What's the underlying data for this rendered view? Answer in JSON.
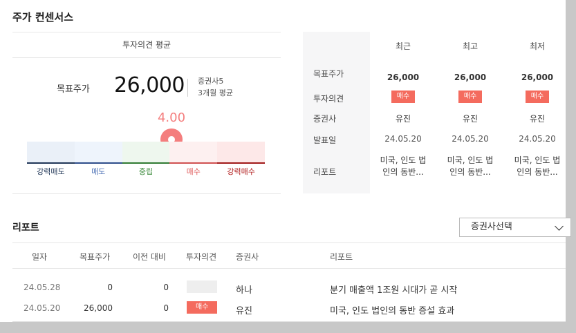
{
  "section_title": "주가 컨센서스",
  "average": {
    "header": "투자의견 평균",
    "target_price_label": "목표주가",
    "target_price": "26,000",
    "broker_count": "증권사5",
    "period": "3개월 평균",
    "score": "4.00",
    "bands": [
      "강력매도",
      "매도",
      "중립",
      "매수",
      "강력매수"
    ],
    "band_colors": [
      "#eaf0f8",
      "#eef4fc",
      "#eef7ee",
      "#fdf0f0",
      "#fde8e8"
    ],
    "band_line_colors": [
      "#1f3556",
      "#2d4c8a",
      "#2f7a32",
      "#d05050",
      "#a01818"
    ],
    "band_label_colors": [
      "#1f3556",
      "#4a6fb5",
      "#3a8a3a",
      "#e05a5a",
      "#b01a1a"
    ],
    "score_fraction": 0.6
  },
  "compare": {
    "headers": [
      "최근",
      "최고",
      "최저"
    ],
    "row_labels": [
      "목표주가",
      "투자의견",
      "증권사",
      "발표일",
      "리포트"
    ],
    "columns": [
      {
        "price": "26,000",
        "opinion": "매수",
        "broker": "유진",
        "date": "24.05.20",
        "report": "미국, 인도 법인의 동반..."
      },
      {
        "price": "26,000",
        "opinion": "매수",
        "broker": "유진",
        "date": "24.05.20",
        "report": "미국, 인도 법인의 동반..."
      },
      {
        "price": "26,000",
        "opinion": "매수",
        "broker": "유진",
        "date": "24.05.20",
        "report": "미국, 인도 법인의 동반..."
      }
    ]
  },
  "reports": {
    "title": "리포트",
    "select_label": "증권사선택",
    "columns": [
      "일자",
      "목표주가",
      "이전 대비",
      "투자의견",
      "증권사",
      "리포트"
    ],
    "rows": [
      {
        "date": "24.05.28",
        "price": "0",
        "change": "0",
        "opinion": "",
        "broker": "하나",
        "report": "분기 매출액 1조원 시대가 곧 시작"
      },
      {
        "date": "24.05.20",
        "price": "26,000",
        "change": "0",
        "opinion": "매수",
        "broker": "유진",
        "report": "미국, 인도 법인의 동반 증설 효과"
      }
    ]
  },
  "accent": "#f46b5e"
}
